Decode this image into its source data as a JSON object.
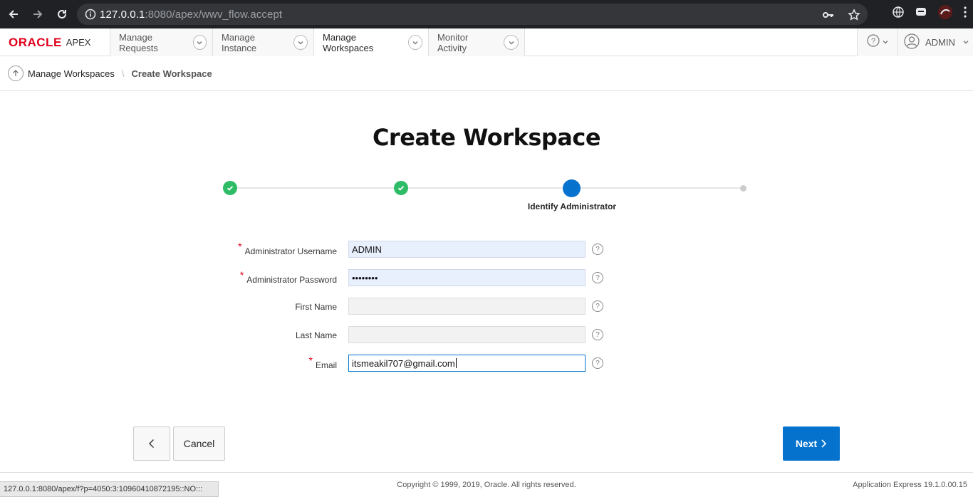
{
  "browser": {
    "url_host": "127.0.0.1",
    "url_rest": ":8080/apex/wwv_flow.accept"
  },
  "nav": {
    "brand": "ORACLE",
    "product": "APEX",
    "tabs": [
      {
        "label": "Manage Requests"
      },
      {
        "label": "Manage Instance"
      },
      {
        "label": "Manage Workspaces"
      },
      {
        "label": "Monitor Activity"
      }
    ],
    "user": "ADMIN"
  },
  "breadcrumb": {
    "parent": "Manage Workspaces",
    "current": "Create Workspace"
  },
  "page": {
    "title": "Create Workspace",
    "current_step_label": "Identify Administrator"
  },
  "form": {
    "username_label": "Administrator Username",
    "username_value": "ADMIN",
    "password_label": "Administrator Password",
    "password_value": "••••••••",
    "firstname_label": "First Name",
    "firstname_value": "",
    "lastname_label": "Last Name",
    "lastname_value": "",
    "email_label": "Email",
    "email_value": "itsmeakil707@gmail.com",
    "required_marker": "*",
    "help_glyph": "?"
  },
  "buttons": {
    "cancel": "Cancel",
    "next": "Next"
  },
  "footer": {
    "copyright": "Copyright © 1999, 2019, Oracle. All rights reserved.",
    "version": "Application Express 19.1.0.00.15"
  },
  "status_url": "127.0.0.1:8080/apex/f?p=4050:3:10960410872195::NO:::",
  "colors": {
    "accent": "#0572ce",
    "success": "#2ebc67",
    "required": "#e0001b"
  }
}
